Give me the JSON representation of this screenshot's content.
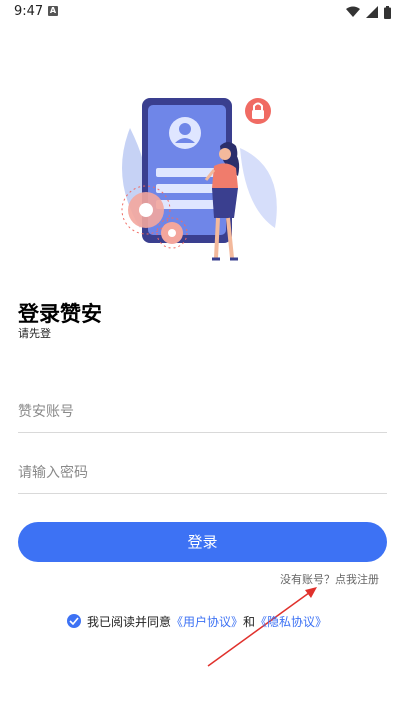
{
  "status_bar": {
    "time": "9:47",
    "notification_letter": "A"
  },
  "illustration": {
    "name": "phone-login-illustration"
  },
  "header": {
    "title": "登录赞安",
    "subtitle": "请先登"
  },
  "form": {
    "account_placeholder": "赞安账号",
    "password_placeholder": "请输入密码",
    "login_label": "登录"
  },
  "register": {
    "label": "没有账号？点我注册"
  },
  "agreement": {
    "prefix": "我已阅读并同意",
    "user_agreement": "《用户协议》",
    "and": "和",
    "privacy_agreement": "《隐私协议》",
    "checked": true
  },
  "colors": {
    "accent": "#3d72f4",
    "arrow": "#e0312c"
  }
}
